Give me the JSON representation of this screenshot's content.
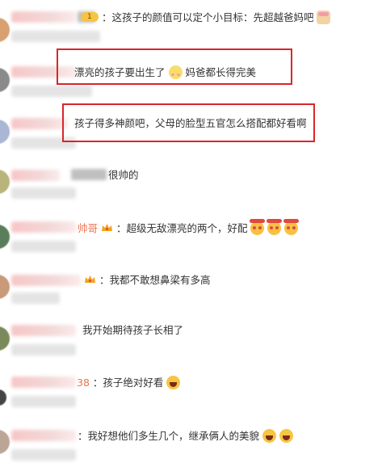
{
  "comments": [
    {
      "id": "c1",
      "username_suffix": "",
      "text": "：这孩子的颜值可以定个小目标：先超越爸妈吧",
      "emoji": "cake-icon"
    },
    {
      "id": "c2",
      "username_suffix": "",
      "text": "漂亮的孩子要出生了",
      "text2": "妈爸都长得完美",
      "emoji": "shy-smile-icon"
    },
    {
      "id": "c3",
      "username_suffix": "",
      "text": "孩子得多神颜吧，父母的脸型五官怎么搭配都好看啊"
    },
    {
      "id": "c4",
      "username_suffix": "",
      "text": "很帅的"
    },
    {
      "id": "c5",
      "username_suffix": "帅哥",
      "text": "：超级无敌漂亮的两个，好配"
    },
    {
      "id": "c6",
      "username_suffix": "",
      "text": "：我都不敢想鼻梁有多高"
    },
    {
      "id": "c7",
      "username_suffix": "",
      "text": "我开始期待孩子长相了"
    },
    {
      "id": "c8",
      "username_suffix": "38",
      "text": "：孩子绝对好看"
    },
    {
      "id": "c9",
      "username_suffix": "",
      "text": "：我好想他们多生几个，继承俩人的美貌"
    }
  ],
  "colors": {
    "highlight_border": "#d9262a",
    "orange_username": "#eb7350",
    "body_text": "#333333"
  }
}
